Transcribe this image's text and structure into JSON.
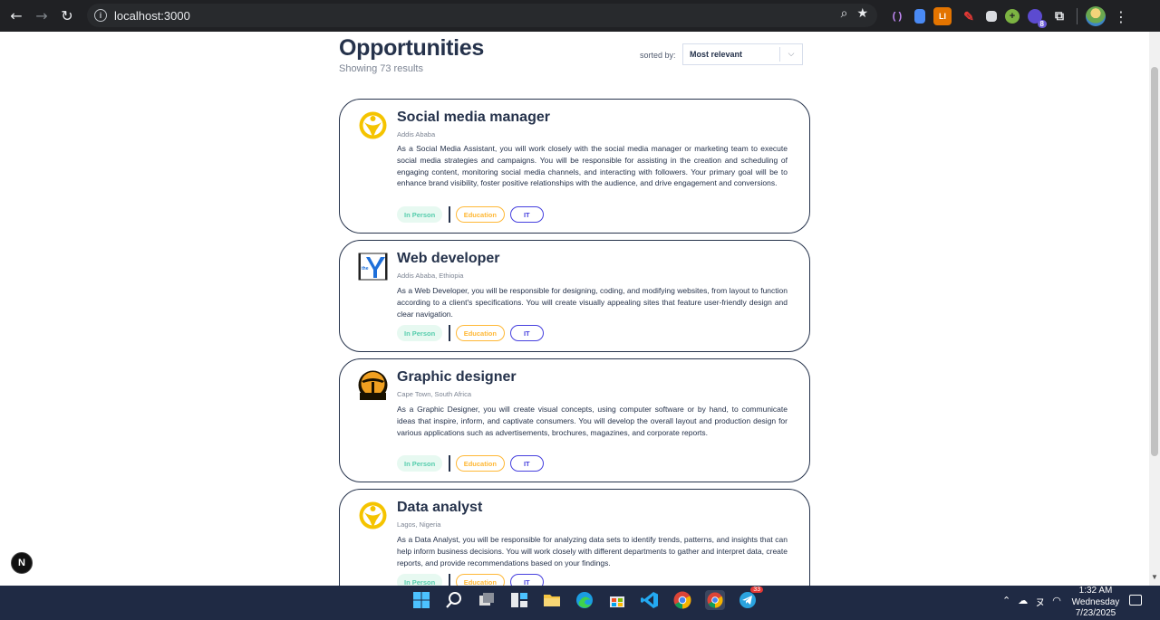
{
  "browser": {
    "url": "localhost:3000",
    "extension_badge": "8"
  },
  "page": {
    "title": "Opportunities",
    "results_text": "Showing 73 results",
    "sort_label": "sorted by:",
    "sort_value": "Most relevant"
  },
  "cards": [
    {
      "title": "Social media manager",
      "location": "Addis Ababa",
      "description": "As a Social Media Assistant, you will work closely with the social media manager or marketing team to execute social media strategies and campaigns. You will be responsible for assisting in the creation and scheduling of engaging content, monitoring social media channels, and interacting with followers. Your primary goal will be to enhance brand visibility, foster positive relationships with the audience, and drive engagement and conversions.",
      "tags": [
        "In Person",
        "Education",
        "IT"
      ],
      "logo": "yellow-figure-logo"
    },
    {
      "title": "Web developer",
      "location": "Addis Ababa, Ethiopia",
      "description": "As a Web Developer, you will be responsible for designing, coding, and modifying websites, from layout to function according to a client's specifications. You will create visually appealing sites that feature user-friendly design and clear navigation.",
      "tags": [
        "In Person",
        "Education",
        "IT"
      ],
      "logo": "ymca-logo"
    },
    {
      "title": "Graphic designer",
      "location": "Cape Town, South Africa",
      "description": "As a Graphic Designer, you will create visual concepts, using computer software or by hand, to communicate ideas that inspire, inform, and captivate consumers. You will develop the overall layout and production design for various applications such as advertisements, brochures, magazines, and corporate reports.",
      "tags": [
        "In Person",
        "Education",
        "IT"
      ],
      "logo": "sunset-tree-logo"
    },
    {
      "title": "Data analyst",
      "location": "Lagos, Nigeria",
      "description": "As a Data Analyst, you will be responsible for analyzing data sets to identify trends, patterns, and insights that can help inform business decisions. You will work closely with different departments to gather and interpret data, create reports, and provide recommendations based on your findings.",
      "tags": [
        "In Person",
        "Education",
        "IT"
      ],
      "logo": "yellow-figure-logo"
    }
  ],
  "dev_badge": "N",
  "taskbar": {
    "time": "1:32 AM",
    "day": "Wednesday",
    "date": "7/23/2025",
    "telegram_badge": "33"
  },
  "colors": {
    "primary_text": "#25324b",
    "muted_text": "#7c8493",
    "tag_inperson": "#56cdad",
    "tag_education": "#ffb836",
    "tag_it": "#4640de"
  }
}
